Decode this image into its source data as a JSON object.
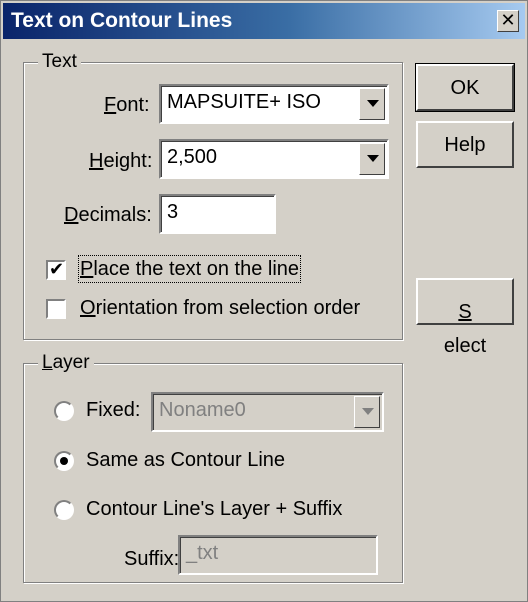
{
  "window": {
    "title": "Text on Contour Lines",
    "close_glyph": "✕"
  },
  "text_group": {
    "legend": "Text",
    "font": {
      "label_accel": "F",
      "label_rest": "ont:",
      "value": "MAPSUITE+ ISO"
    },
    "height": {
      "label_accel": "H",
      "label_rest": "eight:",
      "value": "2,500"
    },
    "decimals": {
      "label_accel": "D",
      "label_rest": "ecimals:",
      "value": "3"
    },
    "place_on_line": {
      "label_accel": "P",
      "label_rest": "lace the text on the line",
      "checked": true
    },
    "orientation": {
      "label_accel": "O",
      "label_rest": "rientation from selection order",
      "checked": false
    }
  },
  "layer_group": {
    "legend_accel": "L",
    "legend_rest": "ayer",
    "fixed": {
      "label": "Fixed:",
      "selected": false,
      "value": "Noname0"
    },
    "same_as_contour": {
      "label": "Same as Contour Line",
      "selected": true
    },
    "contour_suffix": {
      "label": "Contour Line's Layer + Suffix",
      "selected": false
    },
    "suffix": {
      "label": "Suffix:",
      "value": "_txt"
    }
  },
  "buttons": {
    "ok": "OK",
    "help": "Help",
    "select_accel": "S",
    "select_rest": "elect"
  },
  "icons": {
    "dropdown": "chevron-down-icon",
    "check": "checkmark-icon"
  },
  "colors": {
    "title_gradient_start": "#0a246a",
    "title_gradient_end": "#a6caf0",
    "dialog_face": "#d4d0c8"
  }
}
